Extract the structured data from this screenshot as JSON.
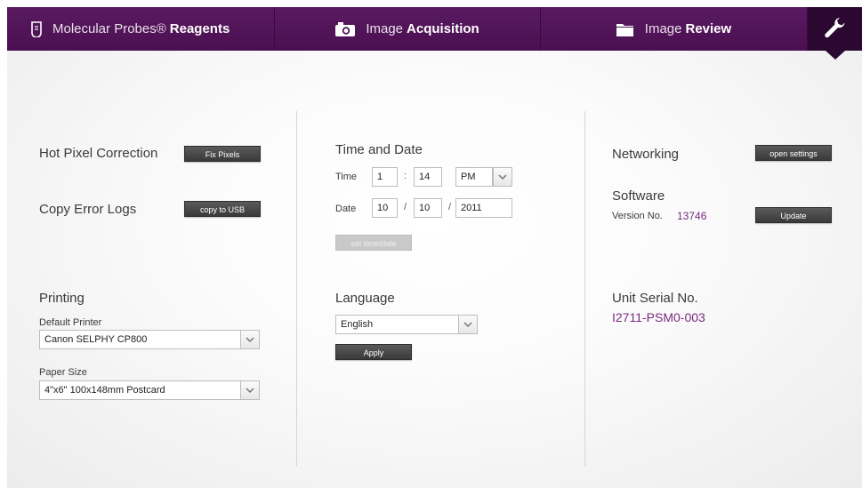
{
  "nav": {
    "tabs": [
      {
        "label_a": "Molecular Probes®",
        "label_b": "Reagents",
        "icon": "vial-icon"
      },
      {
        "label_a": "Image",
        "label_b": "Acquisition",
        "icon": "camera-icon"
      },
      {
        "label_a": "Image",
        "label_b": "Review",
        "icon": "folder-icon"
      },
      {
        "icon": "wrench-icon"
      }
    ],
    "colors": {
      "bar": "#4f1456",
      "active": "#2a0830",
      "accent": "#7a2a7f"
    }
  },
  "left": {
    "hot_pixel": {
      "label": "Hot Pixel Correction",
      "button": "Fix Pixels"
    },
    "error_logs": {
      "label": "Copy Error Logs",
      "button": "copy to USB"
    },
    "printing": {
      "title": "Printing",
      "default_printer_label": "Default Printer",
      "default_printer_value": "Canon SELPHY CP800",
      "paper_size_label": "Paper Size",
      "paper_size_value": "4\"x6\" 100x148mm Postcard"
    }
  },
  "middle": {
    "time_date_title": "Time and Date",
    "time_label": "Time",
    "hour": "1",
    "minute": "14",
    "ampm": "PM",
    "date_label": "Date",
    "month": "10",
    "day": "10",
    "year": "2011",
    "time_sep": ":",
    "date_sep": "/",
    "set_button": "set time/date",
    "language_title": "Language",
    "language_value": "English",
    "apply_button": "Apply"
  },
  "right": {
    "networking_label": "Networking",
    "open_settings_button": "open settings",
    "software_title": "Software",
    "version_label": "Version No.",
    "version_value": "13746",
    "update_button": "Update",
    "serial_title": "Unit Serial No.",
    "serial_value": "I2711-PSM0-003"
  }
}
